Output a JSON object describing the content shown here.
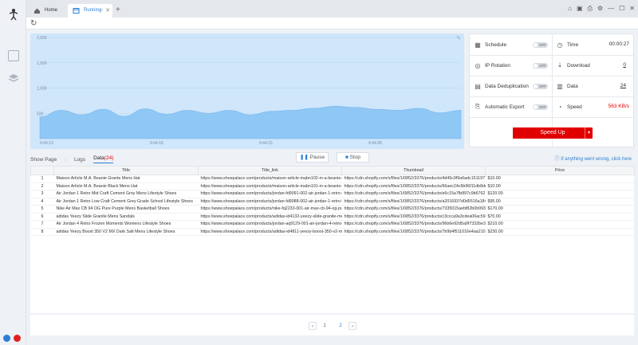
{
  "tabs": [
    {
      "label": "Home"
    },
    {
      "label": "Running-N..."
    }
  ],
  "tab_add": "+",
  "window_controls": [
    "⌂",
    "▣",
    "⎙",
    "⚙",
    "—",
    "☐",
    "✕"
  ],
  "chart_data": {
    "type": "area",
    "yticks": [
      "2,000",
      "1,500",
      "1,000",
      "500",
      "0"
    ],
    "xticks": [
      "9:44:13",
      "9:44:18",
      "9:44:23",
      "9:44:28"
    ],
    "ylim": [
      0,
      2000
    ],
    "x": [
      0,
      1,
      2,
      3,
      4,
      5,
      6,
      7,
      8,
      9,
      10,
      11,
      12,
      13,
      14,
      15,
      16,
      17,
      18,
      19,
      20
    ],
    "values": [
      430,
      560,
      470,
      580,
      440,
      590,
      480,
      560,
      500,
      560,
      470,
      540,
      560,
      600,
      640,
      620,
      580,
      560,
      600,
      510,
      560
    ],
    "color": "#8fc7f5"
  },
  "stats": {
    "schedule": {
      "label": "Schedule",
      "toggle": "OFF"
    },
    "ip_rotation": {
      "label": "IP Rotation",
      "toggle": "OFF"
    },
    "dedup": {
      "label": "Data Deduplication",
      "toggle": "OFF"
    },
    "auto_export": {
      "label": "Automatic Export",
      "toggle": "OFF"
    },
    "time": {
      "label": "Time",
      "value": "00:00:27"
    },
    "download": {
      "label": "Download",
      "value": "0"
    },
    "data": {
      "label": "Data",
      "value": "24"
    },
    "speed": {
      "label": "Speed",
      "value": "563 KB/s"
    }
  },
  "speed_up": "Speed Up",
  "subtabs": {
    "show_page": "Show Page",
    "logs": "Logs",
    "data": "Data",
    "data_count": "(24)"
  },
  "buttons": {
    "pause": "Pause",
    "stop": "Stop"
  },
  "help_text": "If anything went wrong, click here",
  "table": {
    "columns": [
      "Title",
      "Title_link",
      "Thumbnail",
      "Price"
    ],
    "rows": [
      [
        "1",
        "Maison Article M.A. Beanie Grante Mens Hat",
        "https://www.shoepalace.com/products/maison-article-mabn102-m-a-beanie-gr...",
        "https://cdn.shopify.com/s/files/1/0852/3376/products/4d45c9f9a6adc15119779...",
        "$10.00"
      ],
      [
        "2",
        "Maison Article M.A. Beanie Black Mens Hat",
        "https://www.shoepalace.com/products/maison-article-mabn101-m-a-beanie-b...",
        "https://cdn.shopify.com/s/files/1/0852/3376/products/66aec24c6b96f11db8dc4...",
        "$10.00"
      ],
      [
        "3",
        "Air Jordan 1 Retro Mid Craft Cement Grey Mens Lifestyle Shoes",
        "https://www.shoepalace.com/products/jordan-fd9091-002-air-jordan-1-retro-mi...",
        "https://cdn.shopify.com/s/files/1/0852/3376/products/e6c15a7fb897c9b6762...",
        "$120.00"
      ],
      [
        "4",
        "Air Jordan 1 Retro Low Craft Cement Grey Grade School Lifestyle Shoes",
        "https://www.shoepalace.com/products/jordan-fd9088-002-air-jordan-1-retro-lo...",
        "https://cdn.shopify.com/s/files/1/0852/3376/products/a2016937d0d5516a184...",
        "$95.00"
      ],
      [
        "5",
        "Nike Air Max CB 94 OG Pure Purple Mens Basketball Shoes",
        "https://www.shoepalace.com/products/nike-fq2233-001-air-max-cb-94-og-pure...",
        "https://cdn.shopify.com/s/files/1/0852/3376/products/7335015aebf82b0b993d5...",
        "$170.00"
      ],
      [
        "6",
        "adidas Yeezy Slide Granite Mens Sandals",
        "https://www.shoepalace.com/products/adidas-id4132-yeezy-slide-granite-men...",
        "https://cdn.shopify.com/s/files/1/0852/3376/products/c3ccca9a3cdea06ac594f...",
        "$70.00"
      ],
      [
        "7",
        "Air Jordan 4 Retro Frozen Moments Womens Lifestyle Shoes",
        "https://www.shoepalace.com/products/jordan-aq9129-001-air-jordan-4-retro-fr...",
        "https://cdn.shopify.com/s/files/1/0852/3376/products/96b6e92d5a9f7332be3c6...",
        "$210.00"
      ],
      [
        "8",
        "adidas Yeezy Boost 350 V2 MX Dark Salt Mens Lifestyle Shoes",
        "https://www.shoepalace.com/products/adidas-id4811-yeezy-boost-350-v2-mx-...",
        "https://cdn.shopify.com/s/files/1/0852/3376/products/7b9b4f511016e4aa2105...",
        "$230.00"
      ]
    ]
  },
  "pager": {
    "prev": "‹",
    "page1": "1",
    "page2": "2",
    "next": "›"
  }
}
